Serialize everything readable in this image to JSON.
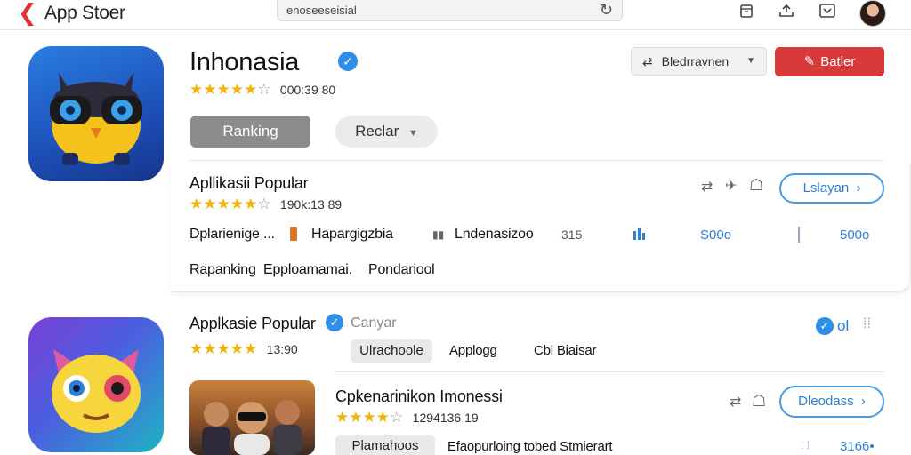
{
  "topbar": {
    "back_symbol": "❮",
    "title": "App Stoer",
    "search_value": "enoseeseisial",
    "icons": [
      "refresh-icon",
      "calendar-icon",
      "share-icon",
      "inbox-icon"
    ]
  },
  "header": {
    "title": "Inhonasia",
    "rating_stars": "★★★★★",
    "rating_empty_star": "☆",
    "rating_count": "000:39  80",
    "tab_ranking": "Ranking",
    "tab_reclar": "Reclar",
    "filter_label": "Bledrravnen",
    "primary_button": "Batler"
  },
  "popular_card": {
    "title": "Apllikasii Popular",
    "rating_stars": "★★★★★",
    "rating_empty_star": "☆",
    "rating_count": "190k:13  89",
    "action_button": "Lslayan",
    "row1": {
      "col1": "Dplarienige ...",
      "col2": "Hapargigzbia",
      "col3": "Lndenasizoo",
      "col4": "315",
      "value1": "S00o",
      "value2": "500o"
    },
    "row2": {
      "col1": "Rapanking",
      "col2": "Epploamamai.",
      "col3": "Pondariool"
    }
  },
  "second_app": {
    "title": "Applkasie Popular",
    "subtitle": "Canyar",
    "rating_stars": "★★★★★",
    "rating_count": "13:90",
    "chip_label": "Ulrachoole",
    "tag1": "Applogg",
    "tag2": "Cbl Biaisar",
    "side_value": "ol"
  },
  "game_item": {
    "title": "Cpkenarinikon Imonessi",
    "rating_stars": "★★★★",
    "rating_empty_star": "☆",
    "rating_count": "1294136  19",
    "action_button": "Dleodass",
    "chip_label": "Plamahoos",
    "description": "Efaopurloing tobed Stmierart",
    "value": "3166•"
  },
  "colors": {
    "accent_red": "#d8393b",
    "accent_blue": "#2b7fd9",
    "star_gold": "#f2b40b"
  }
}
